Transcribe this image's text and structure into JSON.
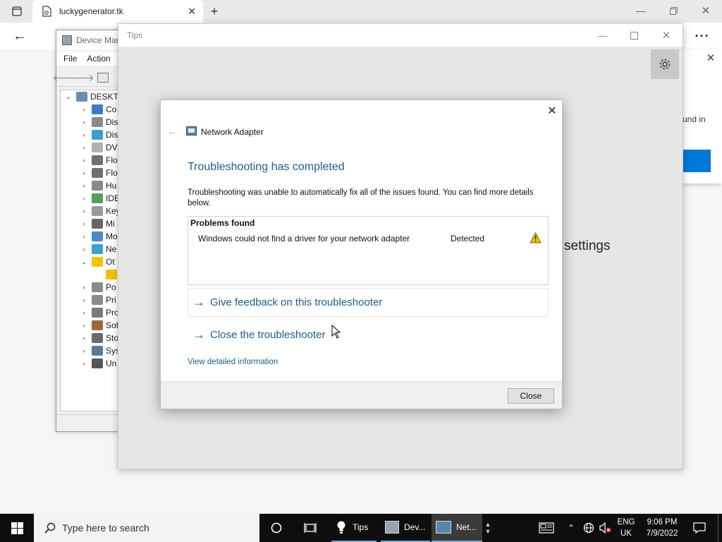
{
  "browser": {
    "tab_title": "luckygenerator.tk"
  },
  "device_manager": {
    "title": "Device Mar",
    "menu": [
      "File",
      "Action"
    ],
    "root_label": "DESKT",
    "items": [
      {
        "label": "Co",
        "expanded": false
      },
      {
        "label": "Dis",
        "expanded": false
      },
      {
        "label": "Dis",
        "expanded": false
      },
      {
        "label": "DV",
        "expanded": false
      },
      {
        "label": "Flo",
        "expanded": false
      },
      {
        "label": "Flo",
        "expanded": false
      },
      {
        "label": "Hu",
        "expanded": false
      },
      {
        "label": "IDE",
        "expanded": false
      },
      {
        "label": "Key",
        "expanded": false
      },
      {
        "label": "Mi",
        "expanded": false
      },
      {
        "label": "Mo",
        "expanded": false
      },
      {
        "label": "Ne",
        "expanded": false
      },
      {
        "label": "Ot",
        "expanded": true
      },
      {
        "label": "",
        "expanded": false
      },
      {
        "label": "Po",
        "expanded": false
      },
      {
        "label": "Pri",
        "expanded": false
      },
      {
        "label": "Pro",
        "expanded": false
      },
      {
        "label": "Sof",
        "expanded": false
      },
      {
        "label": "Sto",
        "expanded": false
      },
      {
        "label": "Sys",
        "expanded": false
      },
      {
        "label": "Un",
        "expanded": false
      }
    ]
  },
  "tips": {
    "title": "Tips",
    "partial_text": "settings"
  },
  "side_panel": {
    "partial_text": "und in"
  },
  "dialog": {
    "breadcrumb": "Network Adapter",
    "heading": "Troubleshooting has completed",
    "description": "Troubleshooting was unable to automatically fix all of the issues found. You can find more details below.",
    "problems_header": "Problems found",
    "problem": {
      "text": "Windows could not find a driver for your network adapter",
      "status": "Detected"
    },
    "feedback_link": "Give feedback on this troubleshooter",
    "close_link": "Close the troubleshooter",
    "details_link": "View detailed information",
    "close_button": "Close"
  },
  "taskbar": {
    "search_placeholder": "Type here to search",
    "apps": [
      {
        "label": "Tips"
      },
      {
        "label": "Dev..."
      },
      {
        "label": "Net..."
      }
    ],
    "lang_top": "ENG",
    "lang_bottom": "UK",
    "time": "9:06 PM",
    "date": "7/9/2022"
  },
  "colors": {
    "heading_blue": "#1f5c8e",
    "link_blue": "#0a5ea8",
    "warning_yellow": "#f2c300",
    "accent_blue": "#0078d7"
  }
}
